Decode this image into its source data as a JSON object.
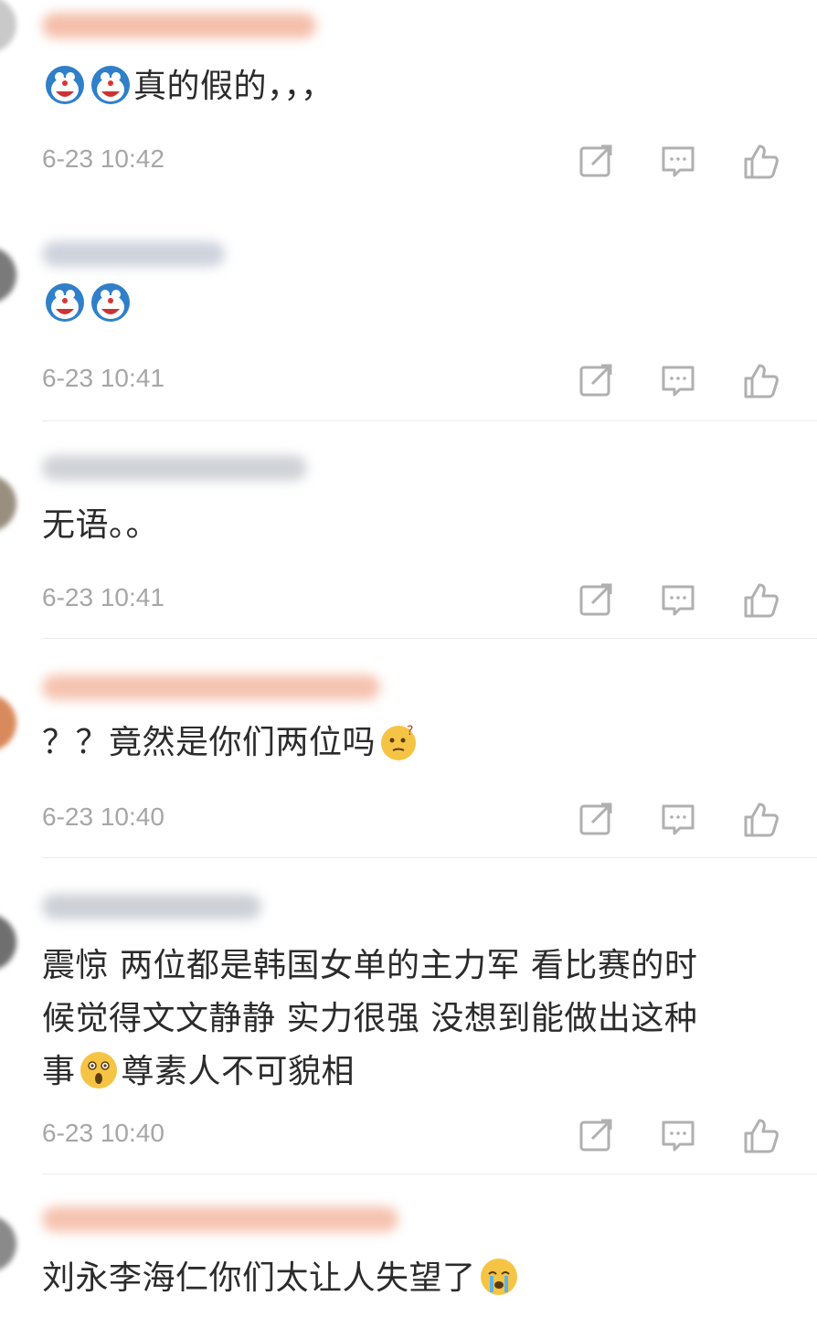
{
  "comments": [
    {
      "text": "真的假的，，，",
      "emojis_before": [
        "doraemon-emoji",
        "doraemon-emoji"
      ],
      "time": "6-23 10:42"
    },
    {
      "text": "",
      "emojis_before": [
        "doraemon-emoji",
        "doraemon-emoji"
      ],
      "time": "6-23 10:41"
    },
    {
      "text": "无语。。",
      "time": "6-23 10:41"
    },
    {
      "text": "？？竟然是你们两位吗",
      "emoji_after": "thinking-emoji",
      "time": "6-23 10:40"
    },
    {
      "line1": "震惊 两位都是韩国女单的主力军 看比赛的时",
      "line2": "候觉得文文静静 实力很强 没想到能做出这种",
      "line3a": "事",
      "emoji_mid": "shocked-emoji",
      "line3b": "尊素人不可貌相",
      "time": "6-23 10:40"
    },
    {
      "text": "刘永李海仁你们太让人失望了",
      "emoji_after": "crying-emoji"
    }
  ],
  "icons": {
    "share": "share-icon",
    "reply": "comment-icon",
    "like": "thumbs-up-icon"
  },
  "colors": {
    "text": "#2b2b2b",
    "time": "#a6a6a6",
    "icon": "#b0b0b0"
  }
}
